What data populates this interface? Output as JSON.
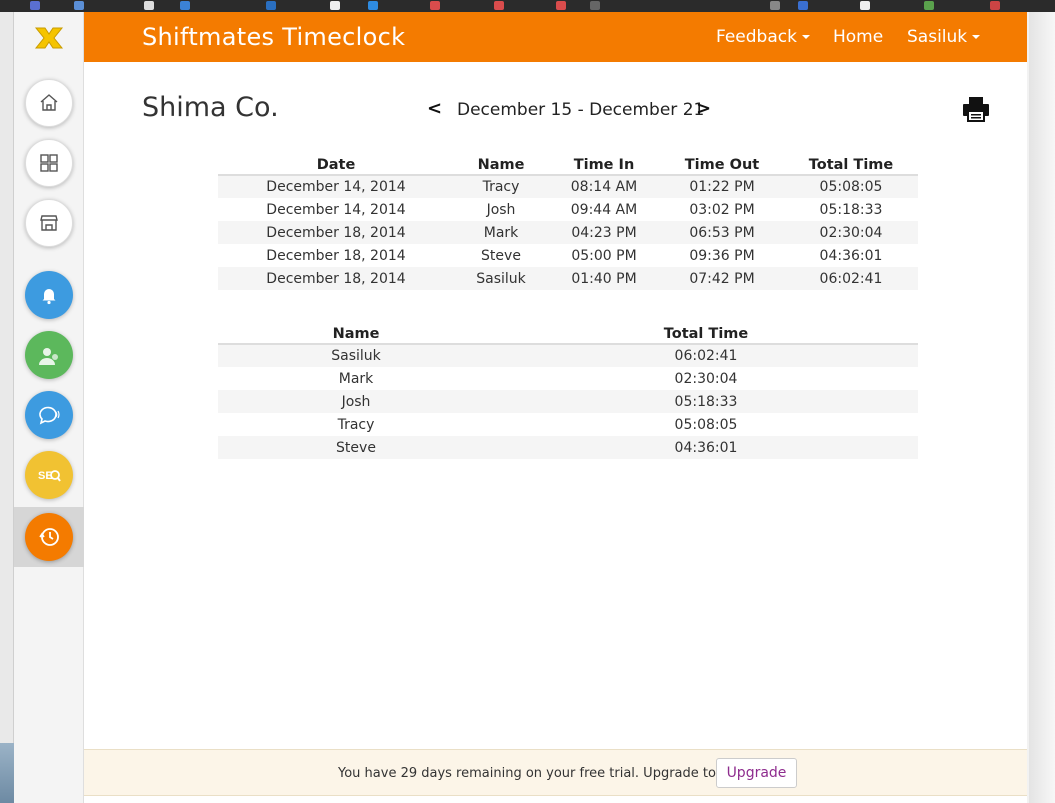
{
  "app": {
    "title": "Shiftmates Timeclock"
  },
  "nav": {
    "feedback": "Feedback",
    "home": "Home",
    "user": "Sasiluk"
  },
  "page": {
    "company": "Shima Co.",
    "week_range": "December 15 - December 21",
    "prev_label": "<",
    "next_label": ">"
  },
  "shifts_table": {
    "headers": [
      "Date",
      "Name",
      "Time In",
      "Time Out",
      "Total Time"
    ],
    "rows": [
      [
        "December 14, 2014",
        "Tracy",
        "08:14 AM",
        "01:22 PM",
        "05:08:05"
      ],
      [
        "December 14, 2014",
        "Josh",
        "09:44 AM",
        "03:02 PM",
        "05:18:33"
      ],
      [
        "December 18, 2014",
        "Mark",
        "04:23 PM",
        "06:53 PM",
        "02:30:04"
      ],
      [
        "December 18, 2014",
        "Steve",
        "05:00 PM",
        "09:36 PM",
        "04:36:01"
      ],
      [
        "December 18, 2014",
        "Sasiluk",
        "01:40 PM",
        "07:42 PM",
        "06:02:41"
      ]
    ]
  },
  "totals_table": {
    "headers": [
      "Name",
      "Total Time"
    ],
    "rows": [
      [
        "Sasiluk",
        "06:02:41"
      ],
      [
        "Mark",
        "02:30:04"
      ],
      [
        "Josh",
        "05:18:33"
      ],
      [
        "Tracy",
        "05:08:05"
      ],
      [
        "Steve",
        "04:36:01"
      ]
    ]
  },
  "trial": {
    "message": "You have 29 days remaining on your free trial. Upgrade today!",
    "upgrade_label": "Upgrade"
  },
  "sidebar": {
    "icons": [
      "home-icon",
      "dashboard-icon",
      "store-icon",
      "notifications-icon",
      "contacts-icon",
      "chat-icon",
      "seo-icon",
      "timeclock-icon"
    ]
  },
  "colors": {
    "brand_orange": "#f47b00",
    "upgrade_purple": "#8e2c8e",
    "trial_bg": "#fcf5e8"
  }
}
